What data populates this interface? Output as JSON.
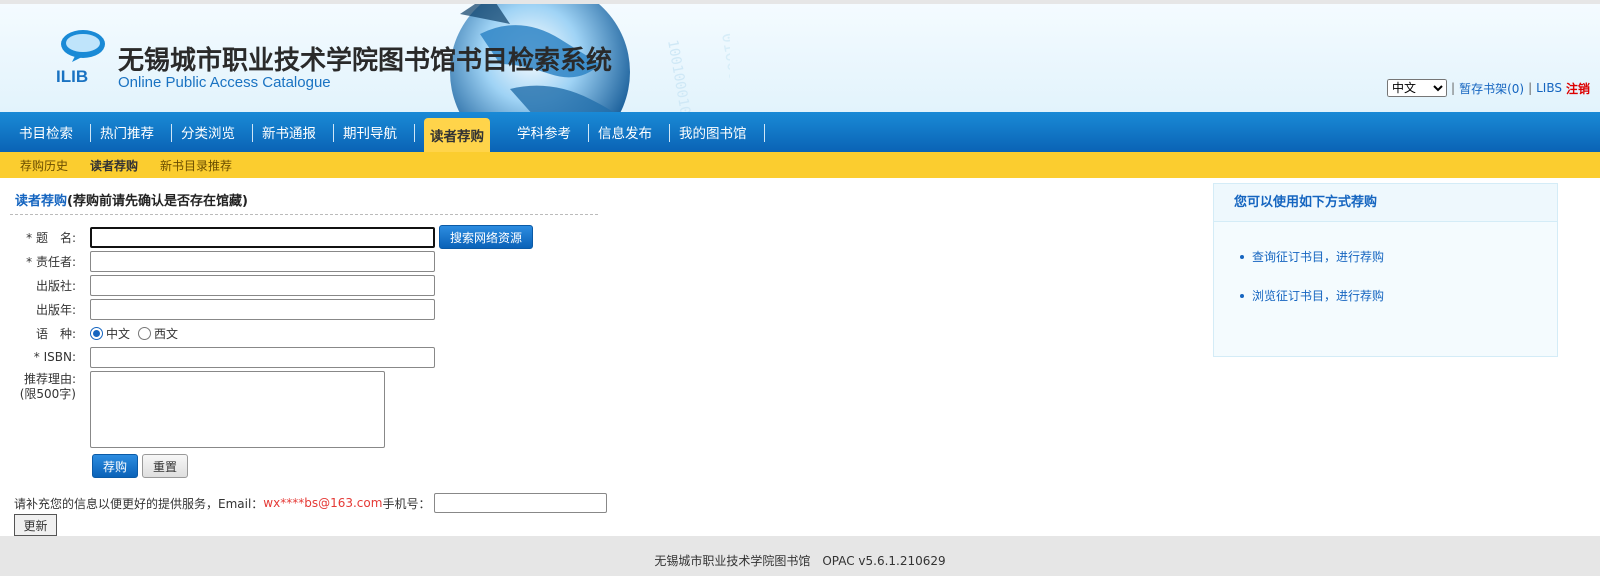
{
  "header": {
    "title": "无锡城市职业技术学院图书馆书目检索系统",
    "subtitle": "Online Public Access Catalogue",
    "logo_text": "ILIB",
    "language_selected": "中文",
    "temp_shelf": "暂存书架(0)",
    "sep1": "|",
    "sep2": "|",
    "user": "LIBS",
    "logout": "注销"
  },
  "nav": {
    "items": [
      "书目检索",
      "热门推荐",
      "分类浏览",
      "新书通报",
      "期刊导航",
      "读者荐购",
      "学科参考",
      "信息发布",
      "我的图书馆"
    ],
    "active": "读者荐购"
  },
  "subnav": {
    "items": [
      "荐购历史",
      "读者荐购",
      "新书目录推荐"
    ],
    "active": "读者荐购"
  },
  "form": {
    "section_title_highlight": "读者荐购",
    "section_title_rest": "(荐购前请先确认是否存在馆藏)",
    "label_title": "* 题　名:",
    "search_web_button": "搜索网络资源",
    "label_author": "* 责任者:",
    "label_publisher": "出版社:",
    "label_year": "出版年:",
    "label_language": "语　种:",
    "lang_option_cn": "中文",
    "lang_option_west": "西文",
    "lang_selected": "中文",
    "label_isbn": "* ISBN:",
    "label_reason_1": "推荐理由:",
    "label_reason_2": "(限500字)",
    "submit_button": "荐购",
    "reset_button": "重置",
    "info_text": "请补充您的信息以便更好的提供服务，Email：",
    "email": "wx****bs@163.com",
    "phone_label": " 手机号：",
    "update_button": "更新"
  },
  "side": {
    "title": "您可以使用如下方式荐购",
    "links": [
      "查询征订书目，进行荐购",
      "浏览征订书目，进行荐购"
    ]
  },
  "footer": {
    "text": "无锡城市职业技术学院图书馆　OPAC v5.6.1.210629"
  }
}
